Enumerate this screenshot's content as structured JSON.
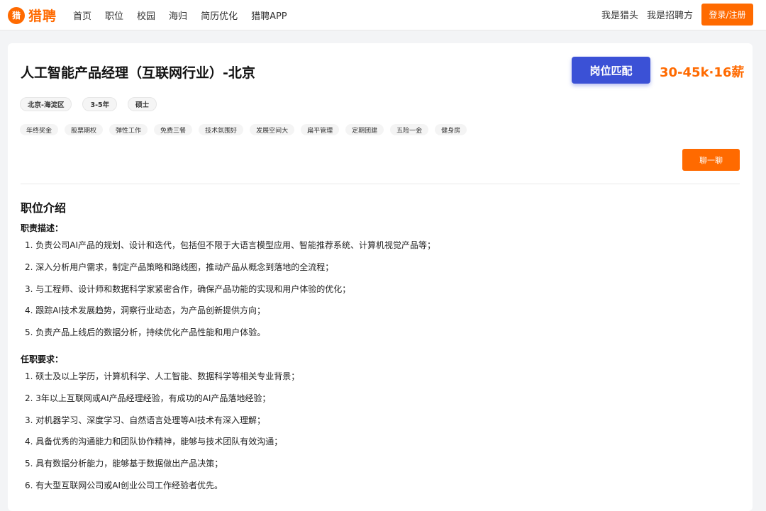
{
  "header": {
    "logo_mark": "猎",
    "logo_text": "猎聘",
    "nav": [
      "首页",
      "职位",
      "校园",
      "海归",
      "简历优化",
      "猎聘APP"
    ],
    "right_links": [
      "我是猎头",
      "我是招聘方"
    ],
    "login_label": "登录/注册"
  },
  "job": {
    "title": "人工智能产品经理（互联网行业）-北京",
    "match_label": "岗位匹配",
    "salary": "30-45k·16薪",
    "basic_tags": [
      "北京-海淀区",
      "3-5年",
      "硕士"
    ],
    "benefit_tags": [
      "年终奖金",
      "股票期权",
      "弹性工作",
      "免费三餐",
      "技术氛围好",
      "发展空间大",
      "扁平管理",
      "定期团建",
      "五险一金",
      "健身房"
    ],
    "chat_label": "聊一聊"
  },
  "description": {
    "section_title": "职位介绍",
    "duties_title": "职责描述：",
    "duties": [
      "1. 负责公司AI产品的规划、设计和迭代，包括但不限于大语言模型应用、智能推荐系统、计算机视觉产品等；",
      "2. 深入分析用户需求，制定产品策略和路线图，推动产品从概念到落地的全流程；",
      "3. 与工程师、设计师和数据科学家紧密合作，确保产品功能的实现和用户体验的优化；",
      "4. 跟踪AI技术发展趋势，洞察行业动态，为产品创新提供方向；",
      "5. 负责产品上线后的数据分析，持续优化产品性能和用户体验。"
    ],
    "requirements_title": "任职要求：",
    "requirements": [
      "1. 硕士及以上学历，计算机科学、人工智能、数据科学等相关专业背景；",
      "2. 3年以上互联网或AI产品经理经验，有成功的AI产品落地经验；",
      "3. 对机器学习、深度学习、自然语言处理等AI技术有深入理解；",
      "4. 具备优秀的沟通能力和团队协作精神，能够与技术团队有效沟通；",
      "5. 具有数据分析能力，能够基于数据做出产品决策；",
      "6. 有大型互联网公司或AI创业公司工作经验者优先。"
    ]
  },
  "colors": {
    "brand": "#ff6a00",
    "match_button": "#3b51d6"
  }
}
